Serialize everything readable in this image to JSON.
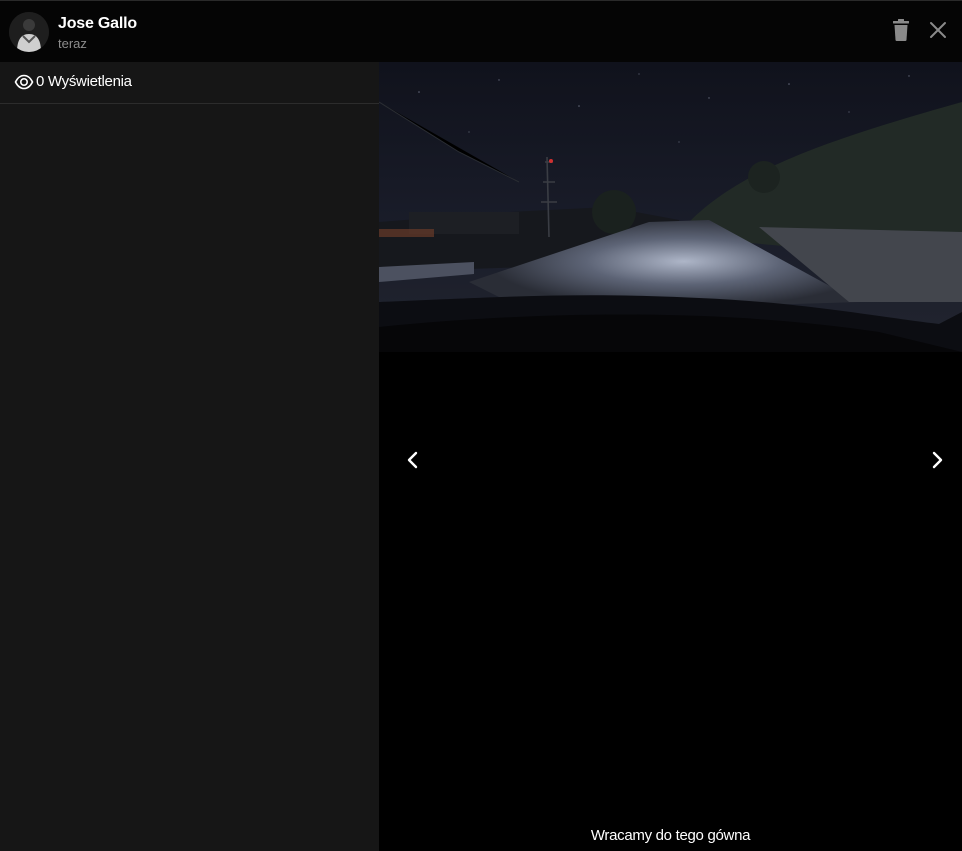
{
  "story": {
    "author": {
      "name": "Jose Gallo",
      "time": "teraz",
      "avatar_icon": "avatar-icon"
    },
    "actions": {
      "delete_icon": "trash-icon",
      "close_icon": "close-icon"
    },
    "stats": {
      "views_label": "0 Wyświetlenia",
      "views_icon": "eye-icon"
    },
    "navigation": {
      "prev_icon": "chevron-left-icon",
      "next_icon": "chevron-right-icon"
    },
    "caption": "Wracamy do tego gówna"
  },
  "colors": {
    "header_bg": "#050505",
    "sidebar_bg": "#161616",
    "viewer_bg": "#000000",
    "muted_text": "#8d8d8d",
    "icon_gray": "#8a8a8a"
  }
}
